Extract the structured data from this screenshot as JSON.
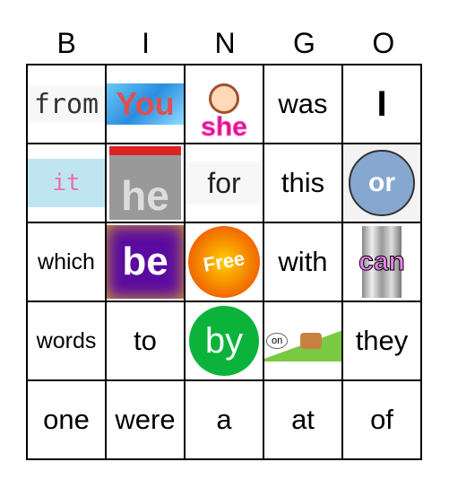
{
  "header": [
    "B",
    "I",
    "N",
    "G",
    "O"
  ],
  "rows": [
    [
      {
        "word": "from",
        "style": "from"
      },
      {
        "word": "You",
        "style": "you"
      },
      {
        "word": "she",
        "style": "she"
      },
      {
        "word": "was",
        "style": "text"
      },
      {
        "word": "I",
        "style": "big"
      }
    ],
    [
      {
        "word": "it",
        "style": "it"
      },
      {
        "word": "he",
        "style": "he"
      },
      {
        "word": "for",
        "style": "for"
      },
      {
        "word": "this",
        "style": "text"
      },
      {
        "word": "or",
        "style": "or"
      }
    ],
    [
      {
        "word": "which",
        "style": "sm"
      },
      {
        "word": "be",
        "style": "be"
      },
      {
        "word": "Free",
        "style": "free"
      },
      {
        "word": "with",
        "style": "text"
      },
      {
        "word": "can",
        "style": "can"
      }
    ],
    [
      {
        "word": "words",
        "style": "sm"
      },
      {
        "word": "to",
        "style": "text"
      },
      {
        "word": "by",
        "style": "by"
      },
      {
        "word": "on",
        "style": "on"
      },
      {
        "word": "they",
        "style": "text"
      }
    ],
    [
      {
        "word": "one",
        "style": "text"
      },
      {
        "word": "were",
        "style": "text"
      },
      {
        "word": "a",
        "style": "text"
      },
      {
        "word": "at",
        "style": "text"
      },
      {
        "word": "of",
        "style": "text"
      }
    ]
  ]
}
